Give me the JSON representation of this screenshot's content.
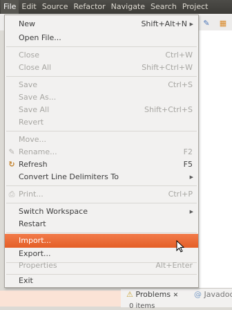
{
  "menubar": {
    "items": [
      {
        "label": "File"
      },
      {
        "label": "Edit"
      },
      {
        "label": "Source"
      },
      {
        "label": "Refactor"
      },
      {
        "label": "Navigate"
      },
      {
        "label": "Search"
      },
      {
        "label": "Project"
      }
    ]
  },
  "menu": {
    "new": {
      "label": "New",
      "shortcut": "Shift+Alt+N"
    },
    "open_file": {
      "label": "Open File..."
    },
    "close": {
      "label": "Close",
      "shortcut": "Ctrl+W"
    },
    "close_all": {
      "label": "Close All",
      "shortcut": "Shift+Ctrl+W"
    },
    "save": {
      "label": "Save",
      "shortcut": "Ctrl+S"
    },
    "save_as": {
      "label": "Save As..."
    },
    "save_all": {
      "label": "Save All",
      "shortcut": "Shift+Ctrl+S"
    },
    "revert": {
      "label": "Revert"
    },
    "move": {
      "label": "Move..."
    },
    "rename": {
      "label": "Rename...",
      "shortcut": "F2"
    },
    "refresh": {
      "label": "Refresh",
      "shortcut": "F5"
    },
    "convert_line_delimiters": {
      "label": "Convert Line Delimiters To"
    },
    "print": {
      "label": "Print...",
      "shortcut": "Ctrl+P"
    },
    "switch_workspace": {
      "label": "Switch Workspace"
    },
    "restart": {
      "label": "Restart"
    },
    "import": {
      "label": "Import..."
    },
    "export": {
      "label": "Export..."
    },
    "properties": {
      "label": "Properties",
      "shortcut": "Alt+Enter"
    },
    "exit": {
      "label": "Exit"
    }
  },
  "bottom_panel": {
    "problems_tab": "Problems",
    "javadoc_tab": "Javadoc",
    "items_count": "0 items"
  },
  "colors": {
    "highlight": "#e9672f",
    "menubar_bg": "#3c3b37",
    "menu_bg": "#f2f1f0",
    "disabled_text": "#a7a6a2"
  }
}
